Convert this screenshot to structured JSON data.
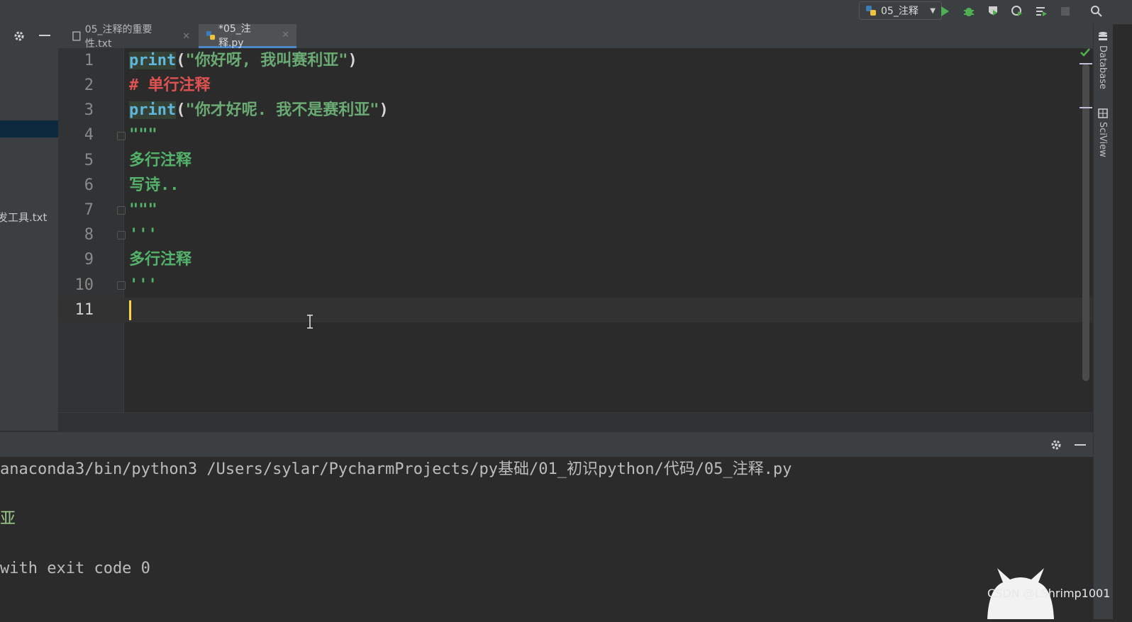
{
  "toolbar": {
    "run_config": "05_注释",
    "icons": [
      "run-icon",
      "debug-icon",
      "coverage-icon",
      "profile-icon",
      "concurrency-icon",
      "stop-icon",
      "search-icon"
    ]
  },
  "tabs": [
    {
      "label": "05_注释的重要性.txt",
      "active": false
    },
    {
      "label": "*05_注释.py",
      "active": true
    }
  ],
  "left_panel": {
    "file_label": "发工具.txt"
  },
  "editor": {
    "line_numbers": [
      "1",
      "2",
      "3",
      "4",
      "5",
      "6",
      "7",
      "8",
      "9",
      "10",
      "11"
    ],
    "lines": {
      "l1_kw": "print",
      "l1_open": "(",
      "l1_str": "\"你好呀, 我叫赛利亚\"",
      "l1_close": ")",
      "l2": "# 单行注释",
      "l3_kw": "print",
      "l3_open": "(",
      "l3_str": "\"你才好呢. 我不是赛利亚\"",
      "l3_close": ")",
      "l4": "\"\"\"",
      "l5": "多行注释",
      "l6": "写诗..",
      "l7": "\"\"\"",
      "l8": "'''",
      "l9": "多行注释",
      "l10": "'''"
    }
  },
  "right_strip": {
    "database": "Database",
    "sciview": "SciView"
  },
  "console": {
    "cmd": "anaconda3/bin/python3 /Users/sylar/PycharmProjects/py基础/01_初识python/代码/05_注释.py",
    "out": "亚",
    "exit": "with exit code 0"
  },
  "watermark": "CSDN @LShrimp1001",
  "colors": {
    "accent": "#4a88c7",
    "keyword": "#5fb7dc",
    "string": "#6aab73",
    "comment": "#e05252",
    "caret": "#ffd24a"
  }
}
